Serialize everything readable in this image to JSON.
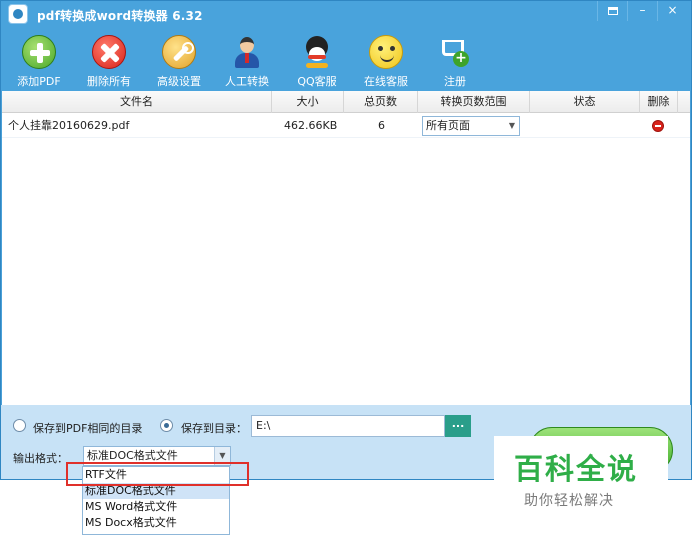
{
  "window": {
    "title": "pdf转换成word转换器 6.32",
    "controls": {
      "restore": "",
      "minimize": "–",
      "close": "×"
    }
  },
  "toolbar": {
    "items": [
      {
        "label": "添加PDF",
        "icon": "add-icon"
      },
      {
        "label": "删除所有",
        "icon": "delete-icon"
      },
      {
        "label": "高级设置",
        "icon": "settings-icon"
      },
      {
        "label": "人工转换",
        "icon": "manual-convert-icon"
      },
      {
        "label": "QQ客服",
        "icon": "qq-icon"
      },
      {
        "label": "在线客服",
        "icon": "online-service-icon"
      },
      {
        "label": "注册",
        "icon": "register-cart-icon"
      }
    ]
  },
  "table": {
    "headers": [
      "文件名",
      "大小",
      "总页数",
      "转换页数范围",
      "状态",
      "删除"
    ],
    "rows": [
      {
        "filename": "个人挂靠20160629.pdf",
        "size": "462.66KB",
        "pages": "6",
        "range": "所有页面",
        "status": ""
      }
    ]
  },
  "output": {
    "same_dir_label": "保存到PDF相同的目录",
    "save_to_label": "保存到目录：",
    "save_path": "E:\\",
    "browse_label": "...",
    "format_label": "输出格式：",
    "format_selected": "标准DOC格式文件",
    "format_options": [
      "RTF文件",
      "标准DOC格式文件",
      "MS Word格式文件",
      "MS Docx格式文件"
    ]
  },
  "watermark": {
    "title": "百科全说",
    "subtitle": "助你轻松解决"
  },
  "colors": {
    "titlebar": "#49a3dc",
    "bottom_panel": "#c7e2f6",
    "highlight_box": "#e0302a",
    "watermark_green": "#2fae48"
  }
}
